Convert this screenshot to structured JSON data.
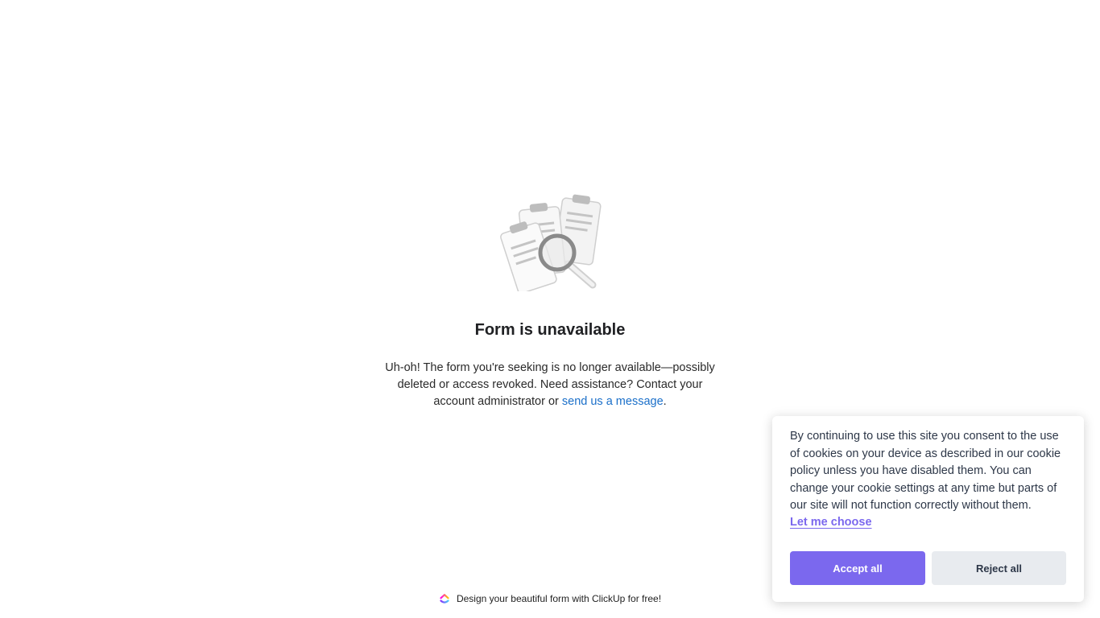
{
  "main": {
    "title": "Form is unavailable",
    "description_part1": "Uh-oh! The form you're seeking is no longer available—possibly deleted or access revoked. Need assistance? Contact your account administrator or ",
    "link_text": "send us a message",
    "description_part2": "."
  },
  "footer": {
    "text": "Design your beautiful form with ClickUp for free!",
    "logo_icon": "clickup-logo-icon"
  },
  "cookie_banner": {
    "message": "By continuing to use this site you consent to the use of cookies on your device as described in our cookie policy unless you have disabled them. You can change your cookie settings at any time but parts of our site will not function correctly without them.",
    "choose_label": "Let me choose",
    "accept_label": "Accept all",
    "reject_label": "Reject all"
  },
  "colors": {
    "accent": "#7b68ee",
    "link": "#1a6fc9",
    "reject_bg": "#e8ebef"
  },
  "illustration": {
    "icon": "clipboards-magnifier-icon"
  }
}
